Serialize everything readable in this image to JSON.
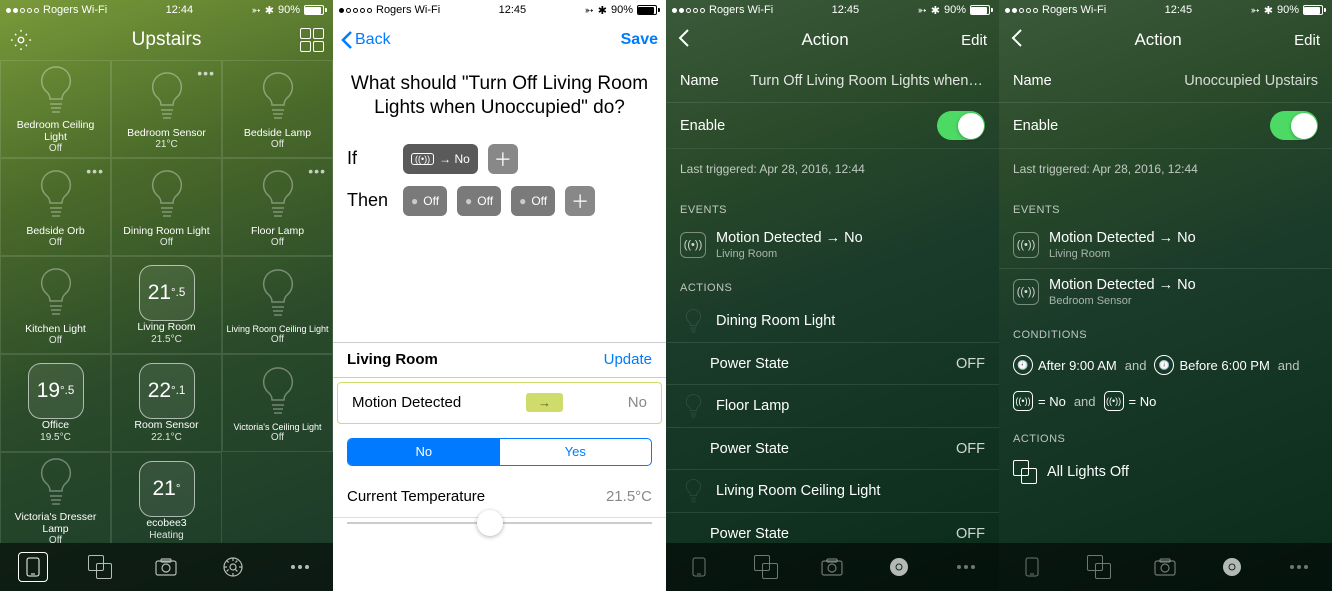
{
  "status": {
    "carrier": "Rogers Wi-Fi",
    "time1": "12:44",
    "time2": "12:45",
    "battery": "90%"
  },
  "screen1": {
    "title": "Upstairs",
    "tiles": [
      {
        "label": "Bedroom Ceiling Light",
        "status": "Off",
        "type": "bulb"
      },
      {
        "label": "Bedroom Sensor",
        "status": "21°C",
        "type": "bulb",
        "dots": true
      },
      {
        "label": "Bedside Lamp",
        "status": "Off",
        "type": "bulb"
      },
      {
        "label": "Bedside Orb",
        "status": "Off",
        "type": "bulb",
        "dots": true
      },
      {
        "label": "Dining Room Light",
        "status": "Off",
        "type": "bulb"
      },
      {
        "label": "Floor Lamp",
        "status": "Off",
        "type": "bulb",
        "dots": true
      },
      {
        "label": "Kitchen Light",
        "status": "Off",
        "type": "bulb"
      },
      {
        "label": "Living Room",
        "status": "21.5°C",
        "type": "temp",
        "temp_big": "21",
        "temp_sm": ".5"
      },
      {
        "label": "Living Room Ceiling Light",
        "status": "Off",
        "type": "bulb",
        "small": true
      },
      {
        "label": "Office",
        "status": "19.5°C",
        "type": "temp",
        "temp_big": "19",
        "temp_sm": ".5"
      },
      {
        "label": "Room Sensor",
        "status": "22.1°C",
        "type": "temp",
        "temp_big": "22",
        "temp_sm": ".1"
      },
      {
        "label": "Victoria's Ceiling Light",
        "status": "Off",
        "type": "bulb",
        "small": true
      },
      {
        "label": "Victoria's Dresser Lamp",
        "status": "Off",
        "type": "bulb"
      },
      {
        "label": "ecobee3",
        "status": "Heating",
        "type": "temp",
        "temp_big": "21",
        "temp_sm": ""
      }
    ]
  },
  "screen2": {
    "back": "Back",
    "save": "Save",
    "question": "What should \"Turn Off Living Room Lights when Unoccupied\" do?",
    "if": "If",
    "then": "Then",
    "if_pill": "→ No",
    "then_off": "Off",
    "subheader": "Living Room",
    "update": "Update",
    "motion_label": "Motion Detected",
    "motion_val": "No",
    "arrow": "→",
    "seg_no": "No",
    "seg_yes": "Yes",
    "curtemp_label": "Current Temperature",
    "curtemp_val": "21.5°C"
  },
  "screen3": {
    "title": "Action",
    "edit": "Edit",
    "name_label": "Name",
    "name_val": "Turn Off Living Room Lights when Unoccup…",
    "enable_label": "Enable",
    "last_triggered": "Last triggered: Apr 28, 2016, 12:44",
    "events_hdr": "EVENTS",
    "events": [
      {
        "title": "Motion Detected → No",
        "sub": "Living Room"
      }
    ],
    "actions_hdr": "ACTIONS",
    "actions": [
      {
        "device": "Dining Room Light"
      },
      {
        "attr": "Power State",
        "val": "OFF"
      },
      {
        "device": "Floor Lamp"
      },
      {
        "attr": "Power State",
        "val": "OFF"
      },
      {
        "device": "Living Room Ceiling Light"
      },
      {
        "attr": "Power State",
        "val": "OFF"
      }
    ]
  },
  "screen4": {
    "title": "Action",
    "edit": "Edit",
    "name_label": "Name",
    "name_val": "Unoccupied Upstairs",
    "enable_label": "Enable",
    "last_triggered": "Last triggered: Apr 28, 2016, 12:44",
    "events_hdr": "EVENTS",
    "events": [
      {
        "title": "Motion Detected → No",
        "sub": "Living Room"
      },
      {
        "title": "Motion Detected → No",
        "sub": "Bedroom Sensor"
      }
    ],
    "conditions_hdr": "CONDITIONS",
    "cond_after": "After 9:00 AM",
    "cond_before": "Before 6:00 PM",
    "cond_and": "and",
    "cond_no": "= No",
    "actions_hdr": "ACTIONS",
    "action_label": "All Lights Off"
  }
}
